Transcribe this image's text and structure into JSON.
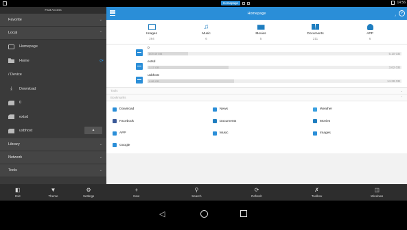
{
  "status_bar": {
    "notification_chip": "Homepage",
    "time": "14:56"
  },
  "sidebar": {
    "fast_access": "Fast Access",
    "favorite": "Favorite",
    "local": "Local",
    "items": [
      {
        "label": "Homepage",
        "icon": "home-icon"
      },
      {
        "label": "Home",
        "icon": "folder-icon"
      },
      {
        "label": "/ Device",
        "icon": "device-icon"
      },
      {
        "label": "Download",
        "icon": "download-icon"
      },
      {
        "label": "0",
        "icon": "sdcard-icon"
      },
      {
        "label": "extsd",
        "icon": "sdcard-icon"
      },
      {
        "label": "usbhost",
        "icon": "sdcard-icon"
      }
    ],
    "library": "Library",
    "network": "Network",
    "tools": "Tools",
    "bottom": [
      {
        "label": "Exit"
      },
      {
        "label": "Theme"
      },
      {
        "label": "Settings"
      }
    ]
  },
  "main": {
    "title": "Homepage",
    "categories": [
      {
        "name": "Images",
        "count": "294"
      },
      {
        "name": "Music",
        "count": "6"
      },
      {
        "name": "Movies",
        "count": "5"
      },
      {
        "name": "Documents",
        "count": "211"
      },
      {
        "name": "APP",
        "count": "6"
      }
    ],
    "storage": [
      {
        "name": "0",
        "used": "809.49 MB",
        "total": "5.10 GB",
        "fill": 0.16
      },
      {
        "name": "extsd",
        "used": "1.17 GB",
        "total": "3.62 GB",
        "fill": 0.32
      },
      {
        "name": "usbhost",
        "used": "4.86 GB",
        "total": "14.38 GB",
        "fill": 0.34
      }
    ],
    "tools_header": "Tools",
    "bookmarks_header": "Bookmarks",
    "bookmarks": [
      [
        {
          "label": "Download",
          "color": "#2a8ed8"
        },
        {
          "label": "News",
          "color": "#2a8ed8"
        },
        {
          "label": "Weather",
          "color": "#3aa0e0"
        }
      ],
      [
        {
          "label": "Facebook",
          "color": "#3b5998"
        },
        {
          "label": "Documents",
          "color": "#1f7ec0"
        },
        {
          "label": "Movies",
          "color": "#1f7ec0"
        }
      ],
      [
        {
          "label": "APP",
          "color": "#2a8ed8"
        },
        {
          "label": "Music",
          "color": "#2a8ed8"
        },
        {
          "label": "Images",
          "color": "#2a8ed8"
        }
      ],
      [
        {
          "label": "Google",
          "color": "#2a8ed8"
        }
      ]
    ],
    "bottom": [
      {
        "label": "New"
      },
      {
        "label": "Search"
      },
      {
        "label": "Refresh"
      },
      {
        "label": "Toolbox"
      },
      {
        "label": "Windows"
      }
    ]
  },
  "accent_color": "#2a8ed8"
}
